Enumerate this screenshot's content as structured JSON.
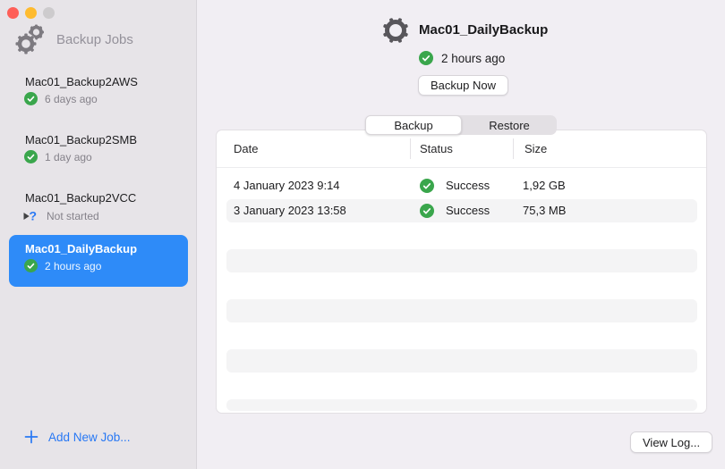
{
  "window": {
    "traffic_lights": {
      "close": "#fe5f58",
      "minimize": "#febb2f",
      "disabled": "#cdcbcd"
    }
  },
  "sidebar": {
    "header_label": "Backup Jobs",
    "jobs": [
      {
        "name": "Mac01_Backup2AWS",
        "status": "6 days ago",
        "status_icon": "success-check"
      },
      {
        "name": "Mac01_Backup2SMB",
        "status": "1 day ago",
        "status_icon": "success-check"
      },
      {
        "name": "Mac01_Backup2VCC",
        "status": "Not started",
        "status_icon": "play-question"
      },
      {
        "name": "Mac01_DailyBackup",
        "status": "2 hours ago",
        "status_icon": "success-check",
        "selected": true
      }
    ],
    "add_job_label": "Add New Job..."
  },
  "main": {
    "title": "Mac01_DailyBackup",
    "last_run": "2 hours ago",
    "backup_now_label": "Backup Now",
    "tabs": {
      "backup": "Backup",
      "restore": "Restore",
      "active_tab": "Backup"
    },
    "table": {
      "columns": {
        "date": "Date",
        "status": "Status",
        "size": "Size"
      },
      "rows": [
        {
          "date": "4 January 2023 9:14",
          "status": "Success",
          "size": "1,92 GB"
        },
        {
          "date": "3 January 2023 13:58",
          "status": "Success",
          "size": "75,3 MB"
        }
      ]
    },
    "view_log_label": "View Log..."
  },
  "icons": {
    "question_glyph": "?"
  },
  "colors": {
    "selection_blue": "#2e8bf8",
    "success_green": "#3aa64c",
    "link_blue": "#2878f4",
    "sidebar_bg": "#e7e4e8",
    "main_bg": "#f1eef3"
  }
}
